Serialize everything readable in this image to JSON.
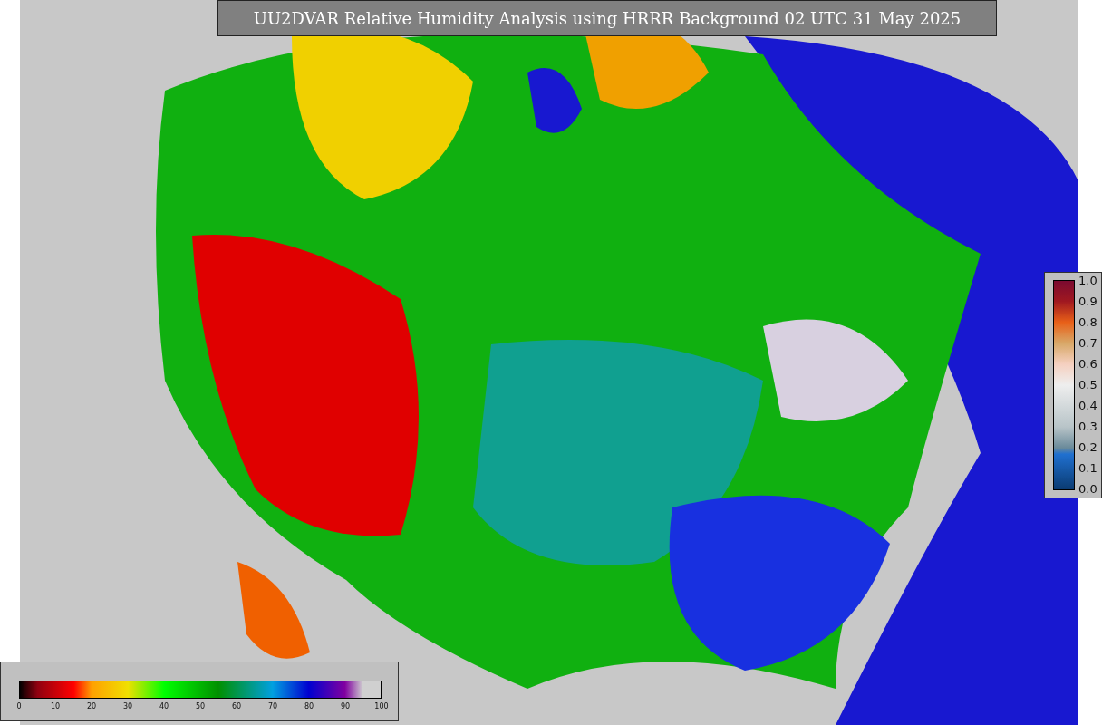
{
  "title": "UU2DVAR Relative Humidity Analysis using HRRR Background 02 UTC 31 May 2025",
  "fraction_colorbar": {
    "ticks": [
      "1.0",
      "0.9",
      "0.8",
      "0.7",
      "0.6",
      "0.5",
      "0.4",
      "0.3",
      "0.2",
      "0.1",
      "0.0"
    ]
  },
  "humidity_colorbar": {
    "ticks": [
      "0",
      "10",
      "20",
      "30",
      "40",
      "50",
      "60",
      "70",
      "80",
      "90",
      "100"
    ]
  }
}
